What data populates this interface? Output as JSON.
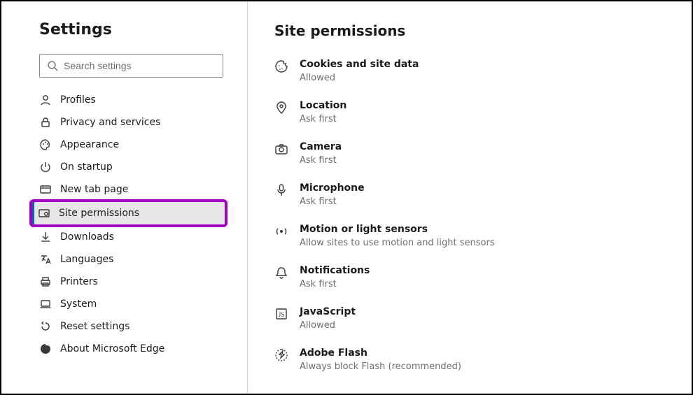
{
  "sidebar": {
    "title": "Settings",
    "search_placeholder": "Search settings",
    "items": [
      {
        "id": "profiles",
        "label": "Profiles"
      },
      {
        "id": "privacy",
        "label": "Privacy and services"
      },
      {
        "id": "appearance",
        "label": "Appearance"
      },
      {
        "id": "startup",
        "label": "On startup"
      },
      {
        "id": "newtab",
        "label": "New tab page"
      },
      {
        "id": "sitepermissions",
        "label": "Site permissions"
      },
      {
        "id": "downloads",
        "label": "Downloads"
      },
      {
        "id": "languages",
        "label": "Languages"
      },
      {
        "id": "printers",
        "label": "Printers"
      },
      {
        "id": "system",
        "label": "System"
      },
      {
        "id": "reset",
        "label": "Reset settings"
      },
      {
        "id": "about",
        "label": "About Microsoft Edge"
      }
    ],
    "selected": "sitepermissions"
  },
  "main": {
    "title": "Site permissions",
    "permissions": [
      {
        "id": "cookies",
        "title": "Cookies and site data",
        "sub": "Allowed"
      },
      {
        "id": "location",
        "title": "Location",
        "sub": "Ask first"
      },
      {
        "id": "camera",
        "title": "Camera",
        "sub": "Ask first"
      },
      {
        "id": "microphone",
        "title": "Microphone",
        "sub": "Ask first"
      },
      {
        "id": "motion",
        "title": "Motion or light sensors",
        "sub": "Allow sites to use motion and light sensors"
      },
      {
        "id": "notifications",
        "title": "Notifications",
        "sub": "Ask first"
      },
      {
        "id": "javascript",
        "title": "JavaScript",
        "sub": "Allowed"
      },
      {
        "id": "flash",
        "title": "Adobe Flash",
        "sub": "Always block Flash (recommended)"
      }
    ]
  }
}
